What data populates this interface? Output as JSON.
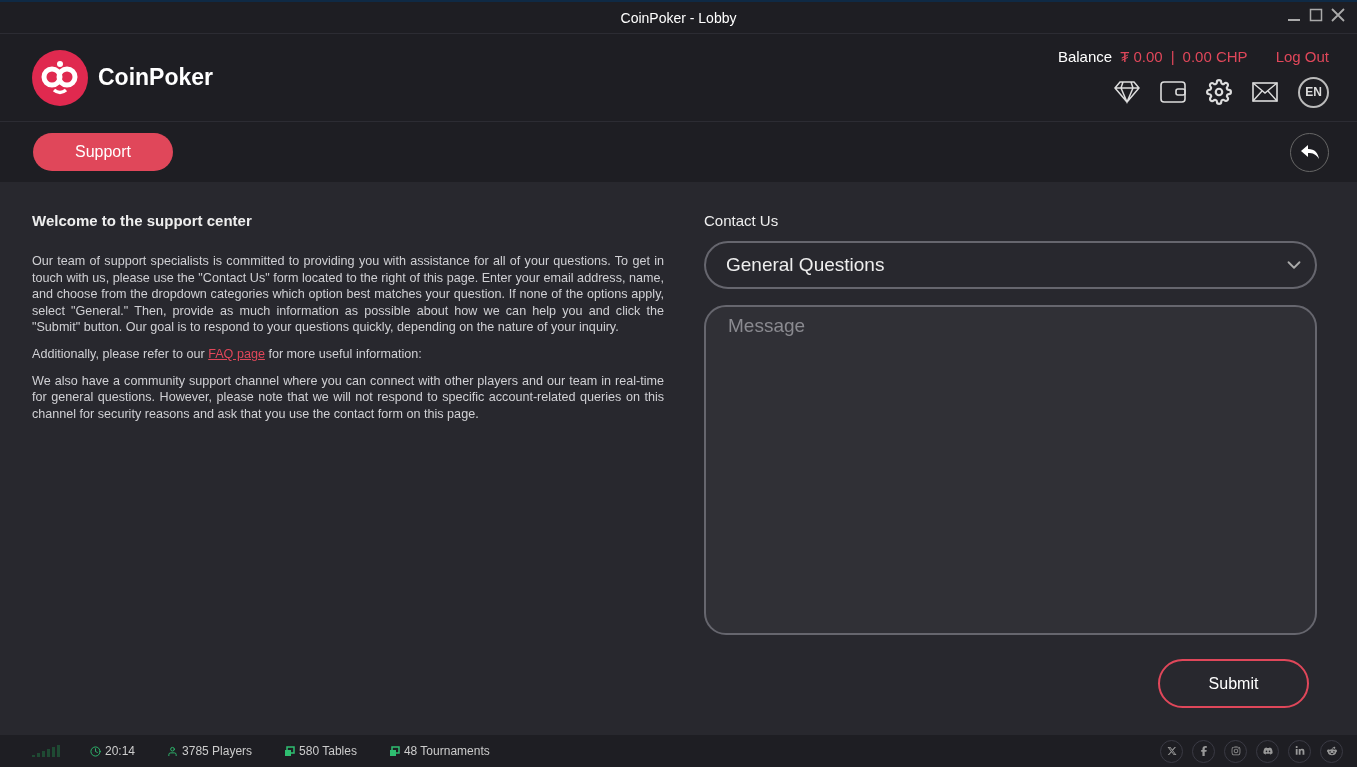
{
  "window": {
    "title": "CoinPoker - Lobby"
  },
  "header": {
    "brand": "CoinPoker",
    "balance_label": "Balance",
    "balance_token": "₮ 0.00",
    "separator": "|",
    "balance_chp": "0.00 CHP",
    "logout": "Log Out",
    "language": "EN"
  },
  "section_tab": {
    "label": "Support",
    "selected": true
  },
  "info": {
    "title": "Welcome to the support center",
    "paragraph_1": "Our team of support specialists is committed to providing you with assistance for all of your questions. To get in touch with us, please use the \"Contact Us\" form located to the right of this page. Enter your email address, name, and choose from the dropdown categories which option best matches your question. If none of the options apply, select \"General.\" Then, provide as much information as possible about how we can help you and click the \"Submit\" button. Our goal is to respond to your questions quickly, depending on the nature of your inquiry.",
    "paragraph_2_before": "Additionally, please refer to our",
    "paragraph_2_link": "FAQ page",
    "paragraph_2_after": "for more useful information:",
    "paragraph_3": "We also have a community support channel where you can connect with other players and our team in real-time for general questions. However, please note that we will not respond to specific account-related queries on this channel for security reasons and ask that you use the contact form on this page."
  },
  "contact": {
    "title": "Contact Us",
    "category": "General Questions",
    "message_placeholder": "Message",
    "submit": "Submit"
  },
  "status_bar": {
    "time": "20:14",
    "players": "3785 Players",
    "tables": "580 Tables",
    "tournaments": "48 Tournaments"
  }
}
